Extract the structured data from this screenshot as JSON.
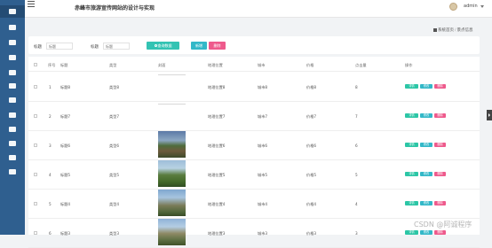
{
  "app": {
    "title": "赤峰市旅游宣传网站的设计与实现"
  },
  "header": {
    "user": "admin"
  },
  "breadcrumb": {
    "home": "系统首页",
    "current": "景点信息"
  },
  "sidebar": {
    "items": [
      "home-icon",
      "menu-icon",
      "menu-icon",
      "menu-icon",
      "menu-icon",
      "menu-icon",
      "menu-icon",
      "menu-icon",
      "menu-icon",
      "menu-icon",
      "menu-icon",
      "user-icon",
      "menu-icon",
      "menu-icon"
    ]
  },
  "filters": {
    "name_label": "标题",
    "name_placeholder": "标题",
    "type_label": "标题",
    "type_placeholder": "标题",
    "search_label": "查询数据",
    "add_label": "新增",
    "delete_label": "删除"
  },
  "table": {
    "headers": [
      "序号",
      "标题",
      "类型",
      "封面",
      "地理位置",
      "城市",
      "价格",
      "点击量",
      "操作"
    ],
    "rows": [
      {
        "idx": "1",
        "title": "标题8",
        "type": "类型8",
        "location": "地理位置8",
        "city": "城市8",
        "price": "价格8",
        "clicks": "8",
        "thumb": "blank"
      },
      {
        "idx": "2",
        "title": "标题7",
        "type": "类型7",
        "location": "地理位置7",
        "city": "城市7",
        "price": "价格7",
        "clicks": "7",
        "thumb": "blank"
      },
      {
        "idx": "3",
        "title": "标题6",
        "type": "类型6",
        "location": "地理位置6",
        "city": "城市6",
        "price": "价格6",
        "clicks": "6",
        "thumb": "t1"
      },
      {
        "idx": "4",
        "title": "标题5",
        "type": "类型5",
        "location": "地理位置5",
        "city": "城市5",
        "price": "价格5",
        "clicks": "5",
        "thumb": "t2"
      },
      {
        "idx": "5",
        "title": "标题4",
        "type": "类型4",
        "location": "地理位置4",
        "city": "城市4",
        "price": "价格4",
        "clicks": "4",
        "thumb": "t3"
      },
      {
        "idx": "6",
        "title": "标题3",
        "type": "类型3",
        "location": "地理位置3",
        "city": "城市3",
        "price": "价格3",
        "clicks": "3",
        "thumb": "t4"
      }
    ],
    "actions": {
      "detail": "详情",
      "edit": "修改",
      "delete": "删除"
    }
  },
  "watermark": "CSDN @阿诚程序",
  "colors": {
    "sidebar": "#2f5f8f",
    "accent_teal": "#33c3b3",
    "accent_pink": "#ee5a8c"
  }
}
